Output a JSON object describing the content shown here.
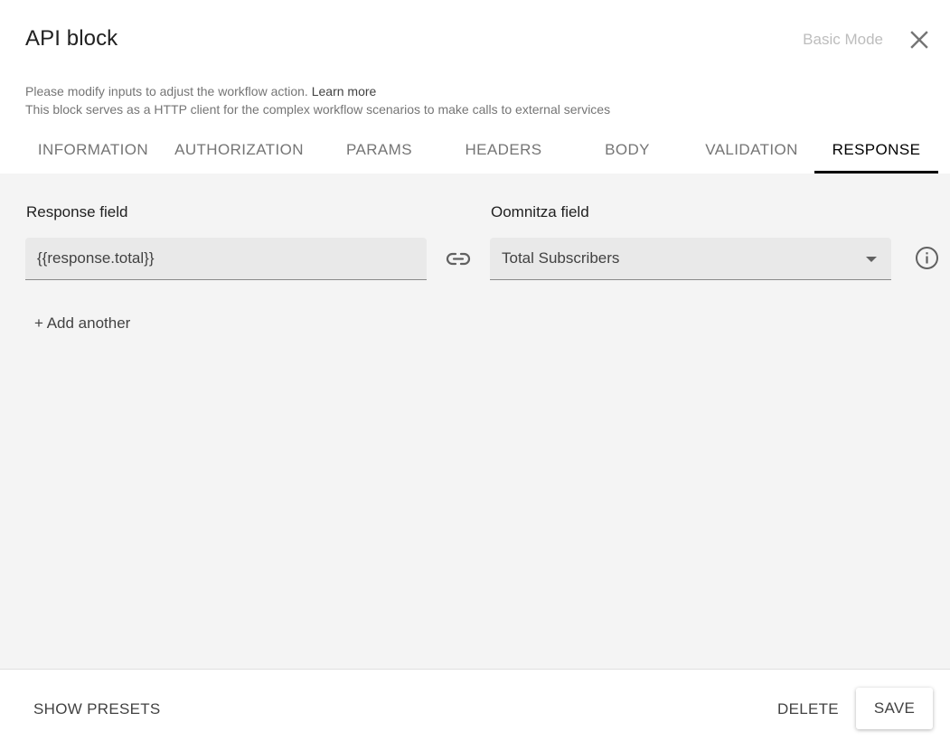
{
  "dialog": {
    "title": "API block",
    "mode_toggle": "Basic Mode",
    "close_icon": "close-icon",
    "description": {
      "line1": "Please modify inputs to adjust the workflow action.",
      "learn_more": "Learn more",
      "line2": "This block serves as a HTTP client for the complex workflow scenarios to make calls to external services"
    }
  },
  "tabs": [
    {
      "label": "INFORMATION"
    },
    {
      "label": "AUTHORIZATION"
    },
    {
      "label": "PARAMS"
    },
    {
      "label": "HEADERS"
    },
    {
      "label": "BODY"
    },
    {
      "label": "VALIDATION"
    },
    {
      "label": "RESPONSE",
      "active": true
    }
  ],
  "response": {
    "response_field_label": "Response field",
    "oomnitza_field_label": "Oomnitza field",
    "mapping": {
      "response_value": "{{response.total}}",
      "oomnitza_value": "Total Subscribers"
    },
    "link_icon": "link-icon",
    "info_icon": "info-icon",
    "add_another": "+ Add another"
  },
  "footer": {
    "show_presets": "SHOW PRESETS",
    "delete": "DELETE",
    "save": "SAVE"
  },
  "colors": {
    "accent": "#000000",
    "content_bg": "#f4f4f4",
    "input_bg": "#e9e9e9",
    "muted_text": "#757575"
  }
}
